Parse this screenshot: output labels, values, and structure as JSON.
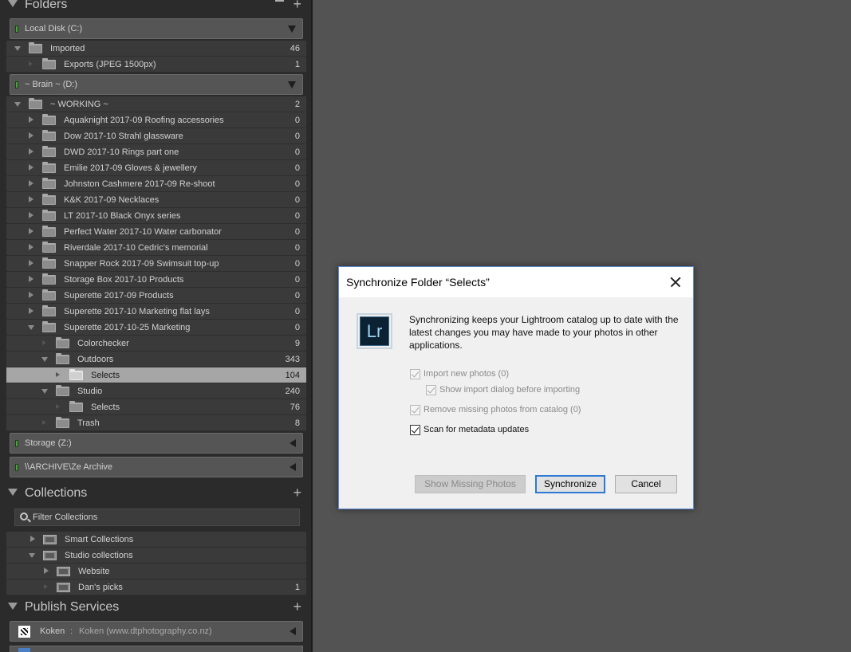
{
  "folders": {
    "title": "Folders",
    "volumes": [
      {
        "name": "Local Disk (C:)"
      },
      {
        "name": "~ Brain ~ (D:)"
      },
      {
        "name": "Storage (Z:)"
      },
      {
        "name": "\\\\ARCHIVE\\Ze Archive"
      }
    ],
    "rows": [
      {
        "label": "Imported",
        "count": "46"
      },
      {
        "label": "Exports (JPEG 1500px)",
        "count": "1"
      },
      {
        "label": "~ WORKING ~",
        "count": "2"
      },
      {
        "label": "Aquaknight 2017-09 Roofing accessories",
        "count": "0"
      },
      {
        "label": "Dow 2017-10 Strahl glassware",
        "count": "0"
      },
      {
        "label": "DWD 2017-10 Rings part one",
        "count": "0"
      },
      {
        "label": "Emilie 2017-09 Gloves & jewellery",
        "count": "0"
      },
      {
        "label": "Johnston Cashmere 2017-09 Re-shoot",
        "count": "0"
      },
      {
        "label": "K&K 2017-09 Necklaces",
        "count": "0"
      },
      {
        "label": "LT 2017-10 Black Onyx series",
        "count": "0"
      },
      {
        "label": "Perfect Water 2017-10 Water carbonator",
        "count": "0"
      },
      {
        "label": "Riverdale 2017-10 Cedric's memorial",
        "count": "0"
      },
      {
        "label": "Snapper Rock 2017-09 Swimsuit top-up",
        "count": "0"
      },
      {
        "label": "Storage Box 2017-10 Products",
        "count": "0"
      },
      {
        "label": "Superette 2017-09 Products",
        "count": "0"
      },
      {
        "label": "Superette 2017-10 Marketing flat lays",
        "count": "0"
      },
      {
        "label": "Superette 2017-10-25 Marketing",
        "count": "0"
      },
      {
        "label": "Colorchecker",
        "count": "9"
      },
      {
        "label": "Outdoors",
        "count": "343"
      },
      {
        "label": "Selects",
        "count": "104"
      },
      {
        "label": "Studio",
        "count": "240"
      },
      {
        "label": "Selects",
        "count": "76"
      },
      {
        "label": "Trash",
        "count": "8"
      }
    ]
  },
  "collections": {
    "title": "Collections",
    "filter_label": "Filter Collections",
    "rows": [
      {
        "label": "Smart Collections",
        "count": ""
      },
      {
        "label": "Studio collections",
        "count": ""
      },
      {
        "label": "Website",
        "count": ""
      },
      {
        "label": "Dan's picks",
        "count": "1"
      }
    ]
  },
  "publish": {
    "title": "Publish Services",
    "service_name": "Koken",
    "separator": ":",
    "service_desc": "Koken (www.dtphotography.co.nz)"
  },
  "dialog": {
    "title": "Synchronize Folder “Selects”",
    "logo_text": "Lr",
    "message": "Synchronizing keeps your Lightroom catalog up to date with the latest changes you may have made to your photos in other applications.",
    "options": {
      "import_new": "Import new photos (0)",
      "show_import": "Show import dialog before importing",
      "remove_missing": "Remove missing photos from catalog (0)",
      "scan_metadata": "Scan for metadata updates"
    },
    "buttons": {
      "show_missing": "Show Missing Photos",
      "synchronize": "Synchronize",
      "cancel": "Cancel"
    }
  }
}
